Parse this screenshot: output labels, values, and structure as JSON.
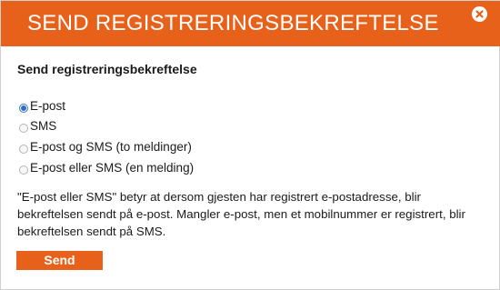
{
  "dialog": {
    "title": "SEND REGISTRERINGSBEKREFTELSE",
    "accent_color": "#e8611a"
  },
  "form": {
    "heading": "Send registreringsbekreftelse",
    "options": [
      {
        "label": "E-post",
        "checked": true
      },
      {
        "label": "SMS",
        "checked": false
      },
      {
        "label": "E-post og SMS (to meldinger)",
        "checked": false
      },
      {
        "label": "E-post eller SMS (en melding)",
        "checked": false
      }
    ],
    "description": "\"E-post eller SMS\" betyr at dersom gjesten har registrert e-postadresse, blir bekreftelsen sendt på e-post. Mangler e-post, men et mobilnummer er registrert, blir bekreftelsen sendt på SMS.",
    "send_label": "Send"
  },
  "icons": {
    "close": "close-icon"
  }
}
